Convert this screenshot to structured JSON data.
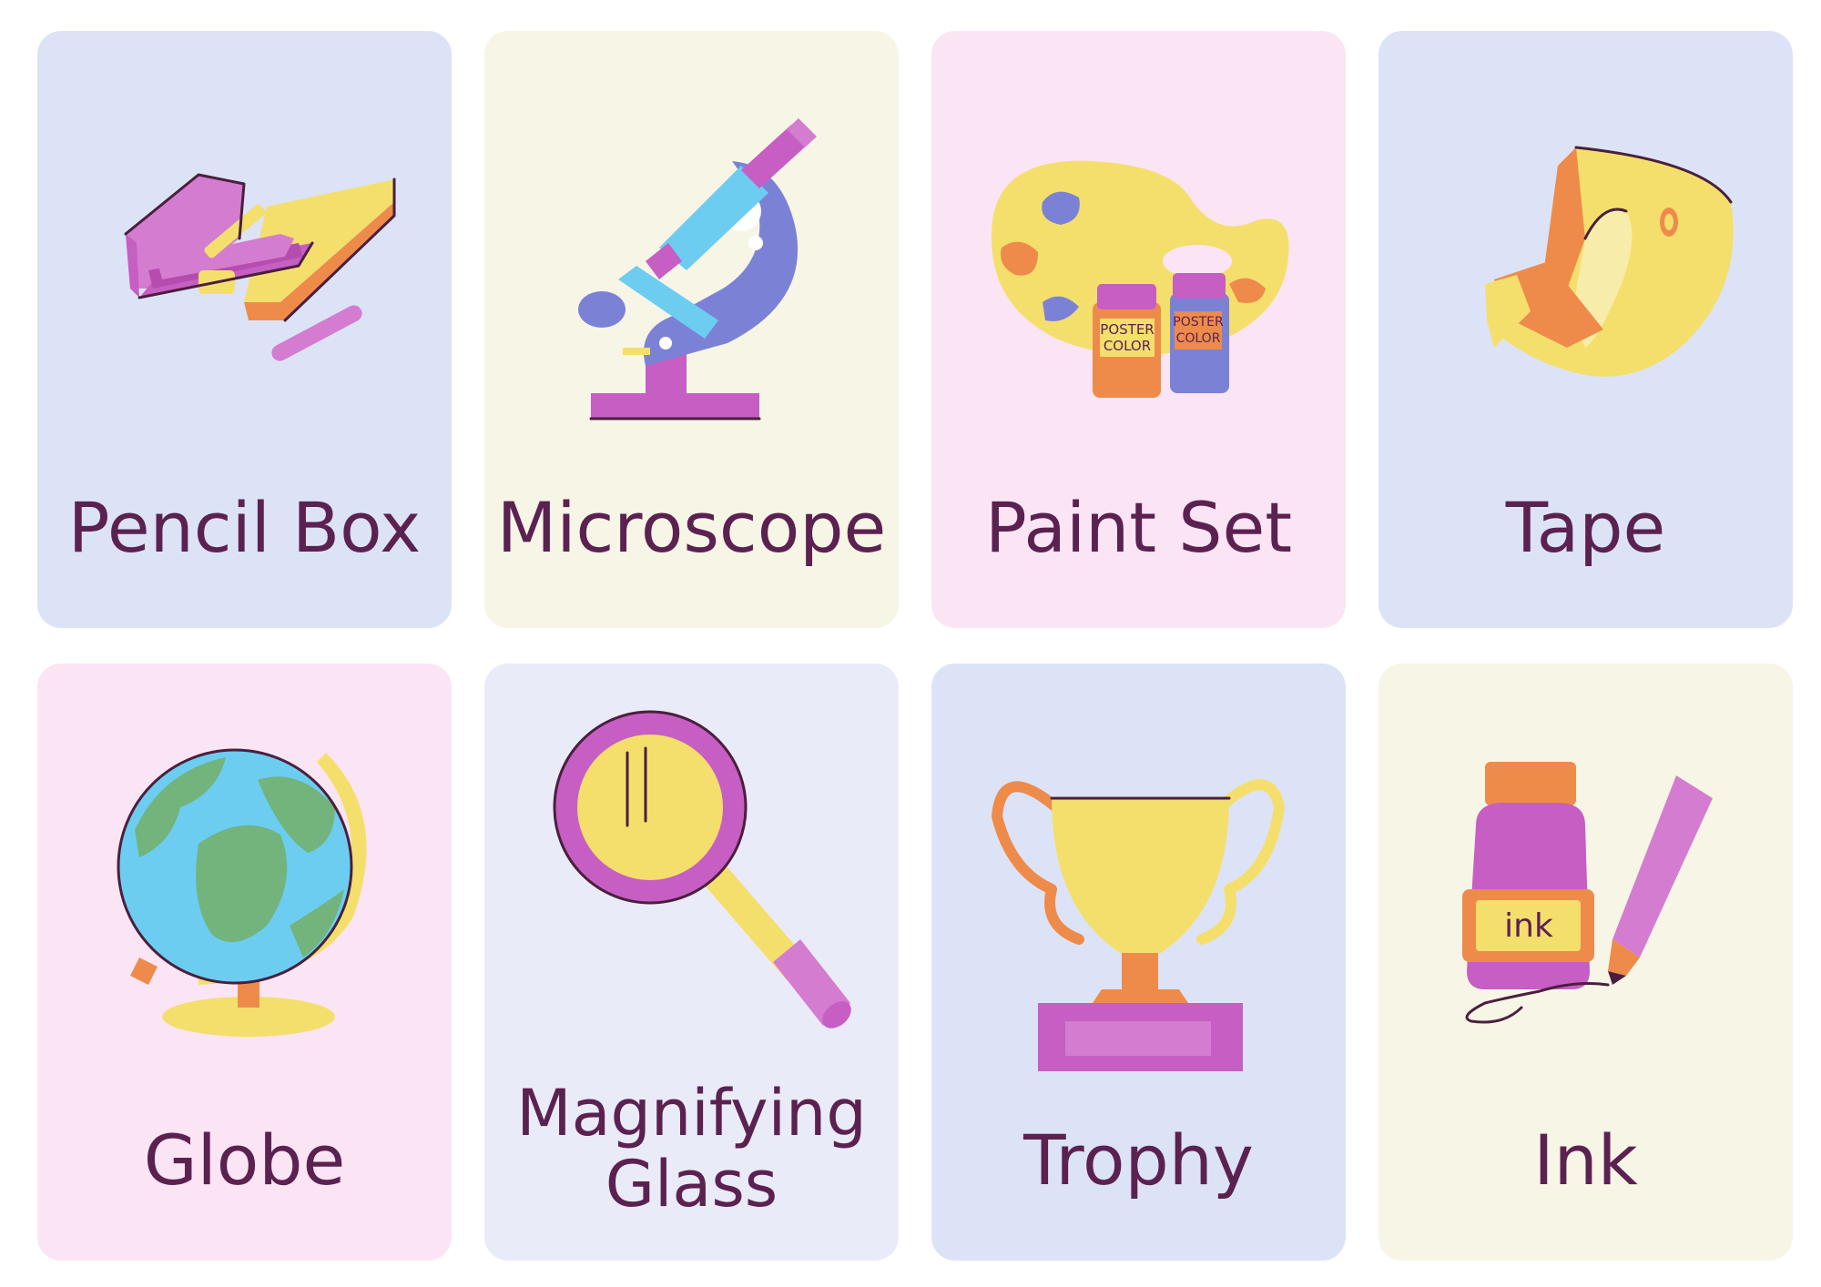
{
  "cards": [
    {
      "label": "Pencil Box",
      "icon": "pencil-box-icon",
      "bg": "#dce3f7"
    },
    {
      "label": "Microscope",
      "icon": "microscope-icon",
      "bg": "#f7f5e6"
    },
    {
      "label": "Paint Set",
      "icon": "paint-palette-icon",
      "bg": "#fbe5f4",
      "jar_label": [
        "POSTER",
        "COLOR"
      ]
    },
    {
      "label": "Tape",
      "icon": "tape-dispenser-icon",
      "bg": "#dce3f7"
    },
    {
      "label": "Globe",
      "icon": "globe-icon",
      "bg": "#fbe5f4"
    },
    {
      "label_lines": [
        "Magnifying",
        "Glass"
      ],
      "icon": "magnifying-glass-icon",
      "bg": "#eaebf9"
    },
    {
      "label": "Trophy",
      "icon": "trophy-icon",
      "bg": "#dce3f7"
    },
    {
      "label": "Ink",
      "icon": "ink-bottle-icon",
      "bg": "#f7f5e6",
      "bottle_label": "ink"
    }
  ],
  "colors": {
    "text": "#5b2150",
    "purple": "#c65ec3",
    "yellow": "#f4df6d",
    "orange": "#ee8b4b",
    "blue": "#6ccdf0",
    "violet": "#7b82d6",
    "green": "#72b47c"
  }
}
